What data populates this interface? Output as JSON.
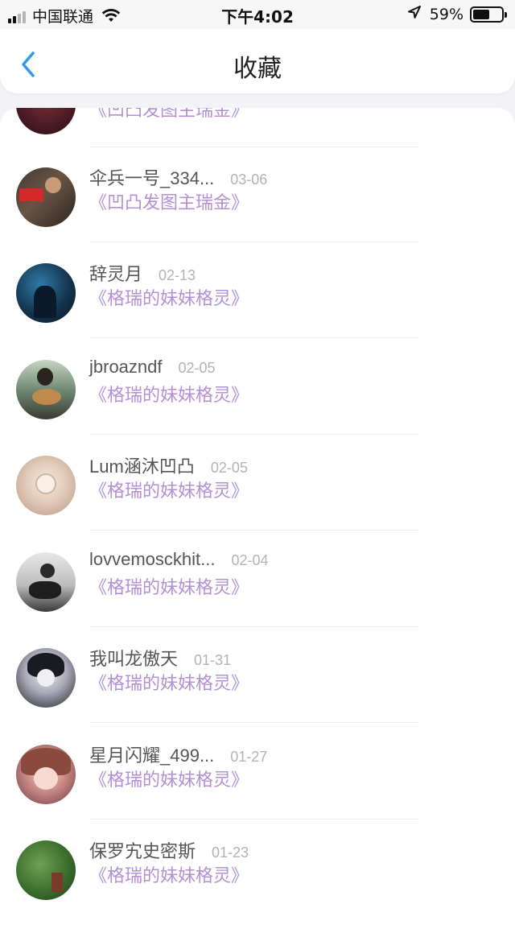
{
  "status_bar": {
    "carrier": "中国联通",
    "time": "下午4:02",
    "battery_text": "59%",
    "battery_level": 0.59,
    "signal_bars": 2
  },
  "nav": {
    "title": "收藏",
    "back_icon": "chevron-left-icon",
    "accent_color": "#2d9bf0"
  },
  "favorites": [
    {
      "username": "",
      "date": "",
      "source": "《凹凸发图主瑞金》"
    },
    {
      "username": "伞兵一号_334...",
      "date": "03-06",
      "source": "《凹凸发图主瑞金》"
    },
    {
      "username": "辞灵月",
      "date": "02-13",
      "source": "《格瑞的妹妹格灵》"
    },
    {
      "username": "jbroazndf",
      "date": "02-05",
      "source": "《格瑞的妹妹格灵》"
    },
    {
      "username": "Lum涵沐凹凸",
      "date": "02-05",
      "source": "《格瑞的妹妹格灵》"
    },
    {
      "username": "lovvemosckhit...",
      "date": "02-04",
      "source": "《格瑞的妹妹格灵》"
    },
    {
      "username": "我叫龙傲天",
      "date": "01-31",
      "source": "《格瑞的妹妹格灵》"
    },
    {
      "username": "星月闪耀_499...",
      "date": "01-27",
      "source": "《格瑞的妹妹格灵》"
    },
    {
      "username": "保罗宄史密斯",
      "date": "01-23",
      "source": "《格瑞的妹妹格灵》"
    }
  ],
  "colors": {
    "source_link": "#b38fd3",
    "date": "#b3b3b3",
    "username": "#555555"
  }
}
